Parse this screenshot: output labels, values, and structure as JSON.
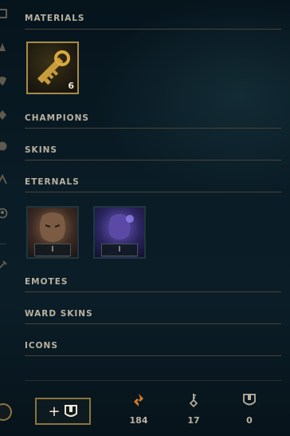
{
  "sections": {
    "materials": "MATERIALS",
    "champions": "CHAMPIONS",
    "skins": "SKINS",
    "eternals": "ETERNALS",
    "emotes": "EMOTES",
    "ward_skins": "WARD SKINS",
    "icons": "ICONS"
  },
  "materials": {
    "key_fragment_count": "6"
  },
  "eternals": [
    {
      "champion": "draven",
      "level": "I"
    },
    {
      "champion": "ryze",
      "level": "I"
    }
  ],
  "footer": {
    "add_button_label": "+",
    "orange_essence": "184",
    "keys": "17",
    "chests": "0"
  },
  "colors": {
    "gold": "#c8aa6e",
    "orange": "#d9792b",
    "text": "#f0e6d2"
  }
}
